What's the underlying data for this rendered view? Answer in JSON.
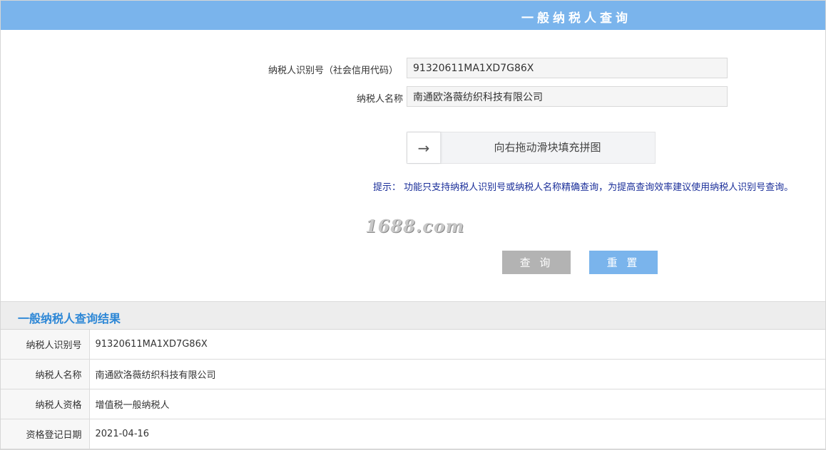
{
  "header": {
    "title": "一般纳税人查询"
  },
  "form": {
    "taxid_label": "纳税人识别号（社会信用代码）",
    "taxid_value": "91320611MA1XD7G86X",
    "name_label": "纳税人名称",
    "name_value": "南通欧洛薇纺织科技有限公司",
    "slider_text": "向右拖动滑块填充拼图",
    "slider_icon": "→",
    "hint": "提示：  功能只支持纳税人识别号或纳税人名称精确查询，为提高查询效率建议使用纳税人识别号查询。",
    "captcha_text": "1688.com",
    "query_label": "查 询",
    "reset_label": "重 置"
  },
  "result": {
    "title": "一般纳税人查询结果",
    "rows": [
      {
        "key": "纳税人识别号",
        "value": "91320611MA1XD7G86X"
      },
      {
        "key": "纳税人名称",
        "value": "南通欧洛薇纺织科技有限公司"
      },
      {
        "key": "纳税人资格",
        "value": "增值税一般纳税人"
      },
      {
        "key": "资格登记日期",
        "value": "2021-04-16"
      }
    ]
  },
  "colors": {
    "header_bg": "#7ab4ec",
    "hint_text": "#1a2e99",
    "result_title": "#2d87d6",
    "query_button": "#b3b3b3",
    "reset_button": "#7ab4ec"
  }
}
